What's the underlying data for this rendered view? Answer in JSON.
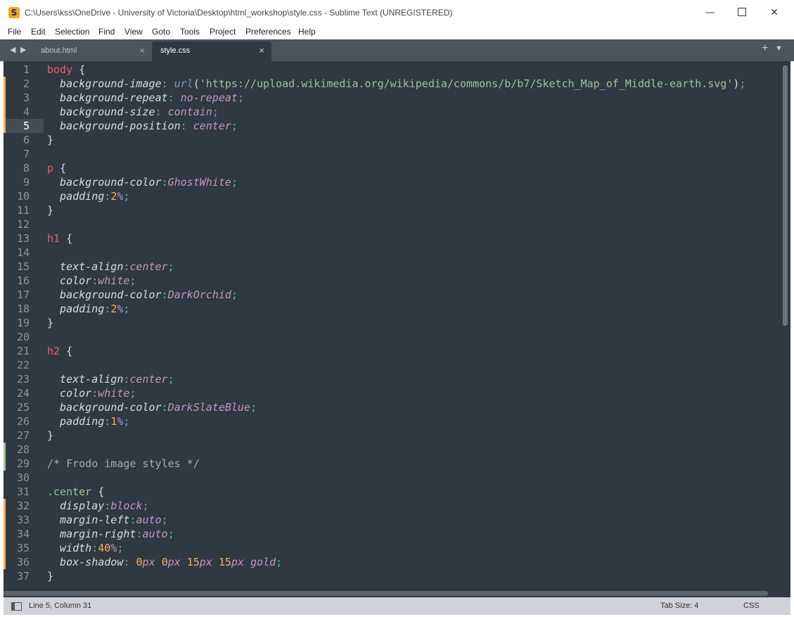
{
  "window": {
    "title": "C:\\Users\\kss\\OneDrive - University of Victoria\\Desktop\\html_workshop\\style.css - Sublime Text (UNREGISTERED)",
    "app_icon": "S"
  },
  "menu": [
    "File",
    "Edit",
    "Selection",
    "Find",
    "View",
    "Goto",
    "Tools",
    "Project",
    "Preferences",
    "Help"
  ],
  "tabs": [
    {
      "label": "about.html",
      "active": false
    },
    {
      "label": "style.css",
      "active": true
    }
  ],
  "icons": {
    "close": "×",
    "back": "◀",
    "forward": "▶",
    "new_tab": "+",
    "tab_menu": "▼",
    "minimize": "—",
    "window_close": "✕"
  },
  "status": {
    "position": "Line 5, Column 31",
    "tab_size": "Tab Size: 4",
    "syntax": "CSS"
  },
  "colors": {
    "editor_bg": "#303841",
    "selector": "#ec5f66",
    "value": "#c594c5",
    "number": "#f9ae58",
    "string": "#99c794",
    "modified_marker": "#f9ae58",
    "added_marker": "#99c794"
  },
  "editor": {
    "active_line": 5,
    "code": [
      {
        "n": "1",
        "tokens": [
          [
            "sel",
            "body"
          ],
          [
            "brace",
            " {"
          ]
        ]
      },
      {
        "n": "2",
        "mark": "mod",
        "tokens": [
          [
            "prop",
            "  background-image"
          ],
          [
            "punc",
            ": "
          ],
          [
            "fn",
            "url"
          ],
          [
            "brace",
            "("
          ],
          [
            "str",
            "'https://upload.wikimedia.org/wikipedia/commons/b/b7/Sketch_Map_of_Middle-earth.svg'"
          ],
          [
            "brace",
            ")"
          ],
          [
            "punc",
            ";"
          ]
        ]
      },
      {
        "n": "3",
        "mark": "mod",
        "tokens": [
          [
            "prop",
            "  background-repeat"
          ],
          [
            "punc",
            ": "
          ],
          [
            "val",
            "no-repeat"
          ],
          [
            "punc",
            ";"
          ]
        ]
      },
      {
        "n": "4",
        "mark": "mod",
        "tokens": [
          [
            "prop",
            "  background-size"
          ],
          [
            "punc",
            ": "
          ],
          [
            "val",
            "contain"
          ],
          [
            "punc",
            ";"
          ]
        ]
      },
      {
        "n": "5",
        "mark": "mod",
        "tokens": [
          [
            "prop",
            "  background-position"
          ],
          [
            "punc",
            ": "
          ],
          [
            "val",
            "center"
          ],
          [
            "punc",
            ";"
          ]
        ]
      },
      {
        "n": "6",
        "tokens": [
          [
            "brace",
            "}"
          ]
        ]
      },
      {
        "n": "7",
        "tokens": []
      },
      {
        "n": "8",
        "tokens": [
          [
            "sel",
            "p"
          ],
          [
            "brace",
            " {"
          ]
        ]
      },
      {
        "n": "9",
        "tokens": [
          [
            "prop",
            "  background-color"
          ],
          [
            "punc",
            ":"
          ],
          [
            "val",
            "GhostWhite"
          ],
          [
            "punc",
            ";"
          ]
        ]
      },
      {
        "n": "10",
        "tokens": [
          [
            "prop",
            "  padding"
          ],
          [
            "punc",
            ":"
          ],
          [
            "num",
            "2"
          ],
          [
            "unit",
            "%"
          ],
          [
            "punc",
            ";"
          ]
        ]
      },
      {
        "n": "11",
        "tokens": [
          [
            "brace",
            "}"
          ]
        ]
      },
      {
        "n": "12",
        "tokens": []
      },
      {
        "n": "13",
        "tokens": [
          [
            "sel",
            "h1"
          ],
          [
            "brace",
            " {"
          ]
        ]
      },
      {
        "n": "14",
        "tokens": []
      },
      {
        "n": "15",
        "tokens": [
          [
            "prop",
            "  text-align"
          ],
          [
            "punc",
            ":"
          ],
          [
            "val",
            "center"
          ],
          [
            "punc",
            ";"
          ]
        ]
      },
      {
        "n": "16",
        "tokens": [
          [
            "prop",
            "  color"
          ],
          [
            "punc",
            ":"
          ],
          [
            "val",
            "white"
          ],
          [
            "punc",
            ";"
          ]
        ]
      },
      {
        "n": "17",
        "tokens": [
          [
            "prop",
            "  background-color"
          ],
          [
            "punc",
            ":"
          ],
          [
            "val",
            "DarkOrchid"
          ],
          [
            "punc",
            ";"
          ]
        ]
      },
      {
        "n": "18",
        "tokens": [
          [
            "prop",
            "  padding"
          ],
          [
            "punc",
            ":"
          ],
          [
            "num",
            "2"
          ],
          [
            "unit",
            "%"
          ],
          [
            "punc",
            ";"
          ]
        ]
      },
      {
        "n": "19",
        "tokens": [
          [
            "brace",
            "}"
          ]
        ]
      },
      {
        "n": "20",
        "tokens": []
      },
      {
        "n": "21",
        "tokens": [
          [
            "sel",
            "h2"
          ],
          [
            "brace",
            " {"
          ]
        ]
      },
      {
        "n": "22",
        "tokens": []
      },
      {
        "n": "23",
        "tokens": [
          [
            "prop",
            "  text-align"
          ],
          [
            "punc",
            ":"
          ],
          [
            "val",
            "center"
          ],
          [
            "punc",
            ";"
          ]
        ]
      },
      {
        "n": "24",
        "tokens": [
          [
            "prop",
            "  color"
          ],
          [
            "punc",
            ":"
          ],
          [
            "val",
            "white"
          ],
          [
            "punc",
            ";"
          ]
        ]
      },
      {
        "n": "25",
        "tokens": [
          [
            "prop",
            "  background-color"
          ],
          [
            "punc",
            ":"
          ],
          [
            "val",
            "DarkSlateBlue"
          ],
          [
            "punc",
            ";"
          ]
        ]
      },
      {
        "n": "26",
        "tokens": [
          [
            "prop",
            "  padding"
          ],
          [
            "punc",
            ":"
          ],
          [
            "num",
            "1"
          ],
          [
            "unit",
            "%"
          ],
          [
            "punc",
            ";"
          ]
        ]
      },
      {
        "n": "27",
        "tokens": [
          [
            "brace",
            "}"
          ]
        ]
      },
      {
        "n": "28",
        "mark": "add",
        "tokens": []
      },
      {
        "n": "29",
        "mark": "add",
        "tokens": [
          [
            "cmt",
            "/* Frodo image styles */"
          ]
        ]
      },
      {
        "n": "30",
        "tokens": []
      },
      {
        "n": "31",
        "tokens": [
          [
            "cls",
            ".center"
          ],
          [
            "brace",
            " {"
          ]
        ]
      },
      {
        "n": "32",
        "mark": "mod",
        "tokens": [
          [
            "prop",
            "  display"
          ],
          [
            "punc",
            ":"
          ],
          [
            "val",
            "block"
          ],
          [
            "punc",
            ";"
          ]
        ]
      },
      {
        "n": "33",
        "mark": "mod",
        "tokens": [
          [
            "prop",
            "  margin-left"
          ],
          [
            "punc",
            ":"
          ],
          [
            "val",
            "auto"
          ],
          [
            "punc",
            ";"
          ]
        ]
      },
      {
        "n": "34",
        "mark": "mod",
        "tokens": [
          [
            "prop",
            "  margin-right"
          ],
          [
            "punc",
            ":"
          ],
          [
            "val",
            "auto"
          ],
          [
            "punc",
            ";"
          ]
        ]
      },
      {
        "n": "35",
        "mark": "mod",
        "tokens": [
          [
            "prop",
            "  width"
          ],
          [
            "punc",
            ":"
          ],
          [
            "num",
            "40"
          ],
          [
            "unit",
            "%"
          ],
          [
            "punc",
            ";"
          ]
        ]
      },
      {
        "n": "36",
        "mark": "mod",
        "tokens": [
          [
            "prop",
            "  box-shadow"
          ],
          [
            "punc",
            ": "
          ],
          [
            "num",
            "0"
          ],
          [
            "unit",
            "px "
          ],
          [
            "num",
            "0"
          ],
          [
            "unit",
            "px "
          ],
          [
            "num",
            "15"
          ],
          [
            "unit",
            "px "
          ],
          [
            "num",
            "15"
          ],
          [
            "unit",
            "px "
          ],
          [
            "val",
            "gold"
          ],
          [
            "punc",
            ";"
          ]
        ]
      },
      {
        "n": "37",
        "tokens": [
          [
            "brace",
            "}"
          ]
        ]
      }
    ]
  }
}
